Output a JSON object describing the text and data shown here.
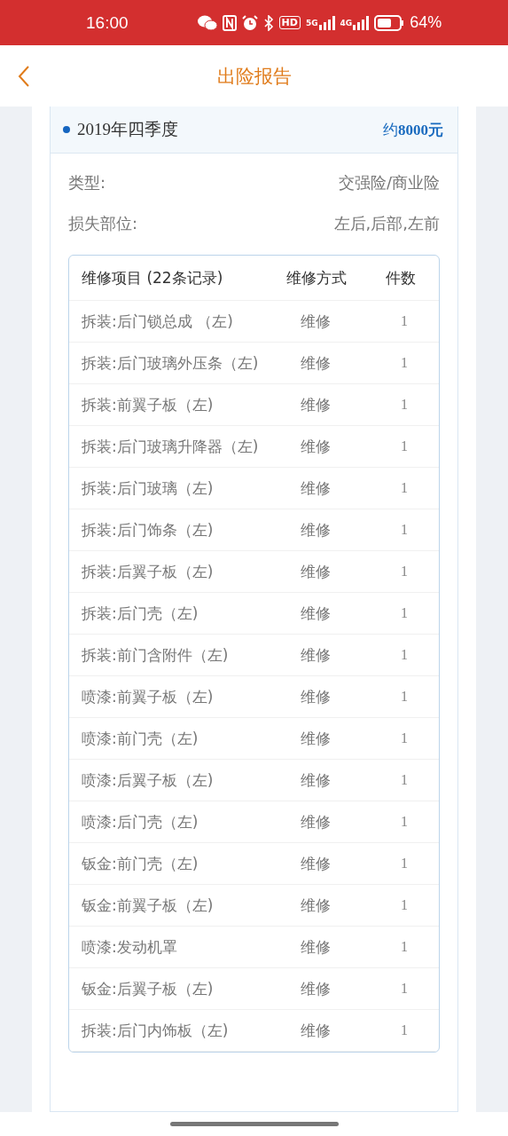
{
  "status_bar": {
    "time": "16:00",
    "hd": "HD",
    "networks": [
      "5G",
      "4G"
    ],
    "battery": "64%"
  },
  "header": {
    "title": "出险报告"
  },
  "report": {
    "period": "2019年四季度",
    "amount_prefix": "约",
    "amount": "8000元",
    "fields": [
      {
        "label": "类型:",
        "value": "交强险/商业险"
      },
      {
        "label": "损失部位:",
        "value": "左后,后部,左前"
      }
    ],
    "table": {
      "columns": [
        "维修项目 (22条记录)",
        "维修方式",
        "件数"
      ],
      "rows": [
        {
          "item": "拆装:后门锁总成 （左)",
          "method": "维修",
          "count": "1"
        },
        {
          "item": "拆装:后门玻璃外压条（左)",
          "method": "维修",
          "count": "1"
        },
        {
          "item": "拆装:前翼子板（左)",
          "method": "维修",
          "count": "1"
        },
        {
          "item": "拆装:后门玻璃升降器（左)",
          "method": "维修",
          "count": "1"
        },
        {
          "item": "拆装:后门玻璃（左)",
          "method": "维修",
          "count": "1"
        },
        {
          "item": "拆装:后门饰条（左)",
          "method": "维修",
          "count": "1"
        },
        {
          "item": "拆装:后翼子板（左)",
          "method": "维修",
          "count": "1"
        },
        {
          "item": "拆装:后门壳（左)",
          "method": "维修",
          "count": "1"
        },
        {
          "item": "拆装:前门含附件（左)",
          "method": "维修",
          "count": "1"
        },
        {
          "item": "喷漆:前翼子板（左)",
          "method": "维修",
          "count": "1"
        },
        {
          "item": "喷漆:前门壳（左)",
          "method": "维修",
          "count": "1"
        },
        {
          "item": "喷漆:后翼子板（左)",
          "method": "维修",
          "count": "1"
        },
        {
          "item": "喷漆:后门壳（左)",
          "method": "维修",
          "count": "1"
        },
        {
          "item": "钣金:前门壳（左)",
          "method": "维修",
          "count": "1"
        },
        {
          "item": "钣金:前翼子板（左)",
          "method": "维修",
          "count": "1"
        },
        {
          "item": "喷漆:发动机罩",
          "method": "维修",
          "count": "1"
        },
        {
          "item": "钣金:后翼子板（左)",
          "method": "维修",
          "count": "1"
        },
        {
          "item": "拆装:后门内饰板（左)",
          "method": "维修",
          "count": "1"
        }
      ]
    }
  }
}
